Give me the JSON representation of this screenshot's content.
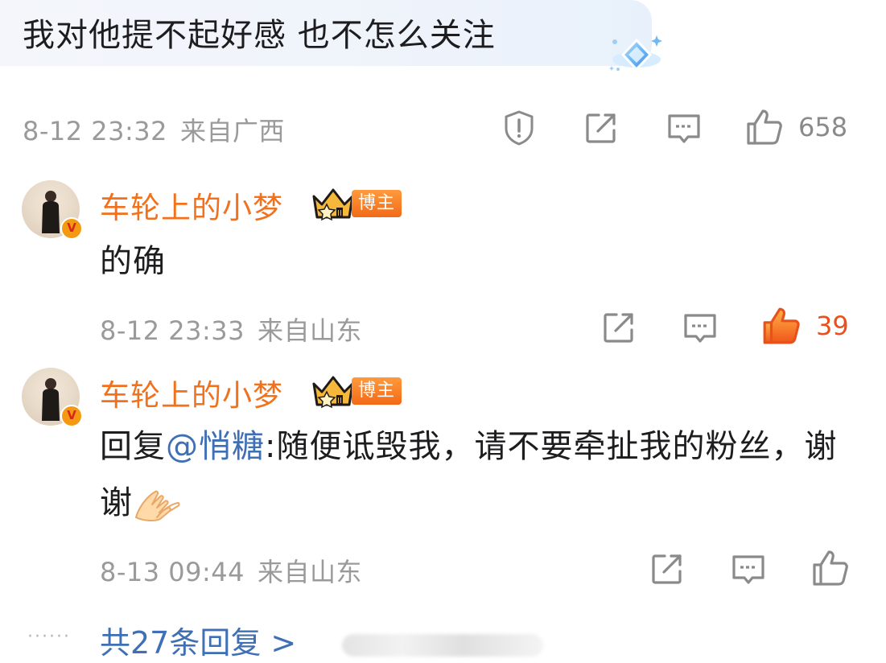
{
  "top_comment": {
    "text": "我对他提不起好感  也不怎么关注",
    "time": "8-12 23:32",
    "location": "来自广西",
    "likes": "658",
    "badge_icon": "diamond-fan-badge-icon"
  },
  "replies": [
    {
      "username": "车轮上的小梦",
      "verified_mark": "V",
      "tag": "博主",
      "text": "的确",
      "time": "8-12 23:33",
      "location": "来自山东",
      "likes": "39",
      "liked": true
    },
    {
      "username": "车轮上的小梦",
      "verified_mark": "V",
      "tag": "博主",
      "text_prefix": "回复",
      "mention": "@悄糖",
      "text": ":随便诋毁我，请不要牵扯我的粉丝，谢谢",
      "time": "8-13 09:44",
      "location": "来自山东",
      "likes": "",
      "liked": false
    }
  ],
  "footer": {
    "dots": "······",
    "more_replies": "共27条回复 >"
  },
  "colors": {
    "username": "#f2711c",
    "liked": "#e8501c",
    "mention": "#3f6fb5",
    "meta": "#9a9a9a"
  }
}
